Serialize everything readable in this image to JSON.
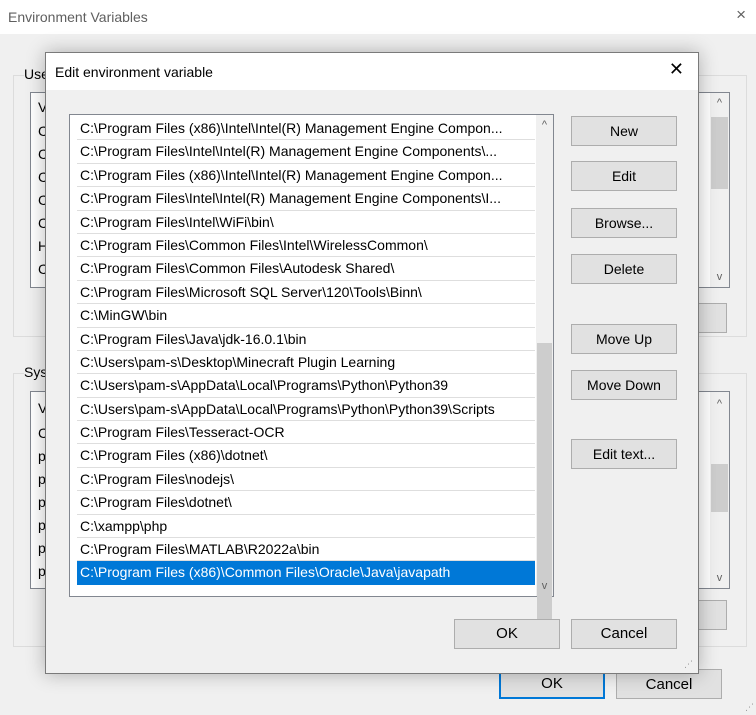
{
  "window": {
    "title": "Environment Variables",
    "close_icon": "×",
    "user_group_label": "Use",
    "user_list_header_char": "V",
    "user_list_chars": [
      "C",
      "C",
      "C",
      "C",
      "C",
      "H",
      "C"
    ],
    "system_group_label": "Sys",
    "system_list_header_char": "V",
    "system_list_chars": [
      "C",
      "p",
      "p",
      "p",
      "p",
      "p",
      "p"
    ],
    "ok_label": "OK",
    "cancel_label": "Cancel"
  },
  "dialog": {
    "title": "Edit environment variable",
    "close_icon": "✕",
    "entries": [
      "C:\\Program Files (x86)\\Intel\\Intel(R) Management Engine Compon...",
      "C:\\Program Files\\Intel\\Intel(R) Management Engine Components\\...",
      "C:\\Program Files (x86)\\Intel\\Intel(R) Management Engine Compon...",
      "C:\\Program Files\\Intel\\Intel(R) Management Engine Components\\I...",
      "C:\\Program Files\\Intel\\WiFi\\bin\\",
      "C:\\Program Files\\Common Files\\Intel\\WirelessCommon\\",
      "C:\\Program Files\\Common Files\\Autodesk Shared\\",
      "C:\\Program Files\\Microsoft SQL Server\\120\\Tools\\Binn\\",
      "C:\\MinGW\\bin",
      "C:\\Program Files\\Java\\jdk-16.0.1\\bin",
      "C:\\Users\\pam-s\\Desktop\\Minecraft Plugin Learning",
      "C:\\Users\\pam-s\\AppData\\Local\\Programs\\Python\\Python39",
      "C:\\Users\\pam-s\\AppData\\Local\\Programs\\Python\\Python39\\Scripts",
      "C:\\Program Files\\Tesseract-OCR",
      "C:\\Program Files (x86)\\dotnet\\",
      "C:\\Program Files\\nodejs\\",
      "C:\\Program Files\\dotnet\\",
      "C:\\xampp\\php",
      "C:\\Program Files\\MATLAB\\R2022a\\bin",
      "C:\\Program Files (x86)\\Common Files\\Oracle\\Java\\javapath"
    ],
    "selected_index": 19,
    "buttons": {
      "new": "New",
      "edit": "Edit",
      "browse": "Browse...",
      "delete": "Delete",
      "move_up": "Move Up",
      "move_down": "Move Down",
      "edit_text": "Edit text..."
    },
    "ok_label": "OK",
    "cancel_label": "Cancel"
  },
  "icons": {
    "scroll_up": "^",
    "scroll_down": "v"
  },
  "colors": {
    "selection": "#0078d7",
    "window_bg": "#f0f0f0"
  }
}
